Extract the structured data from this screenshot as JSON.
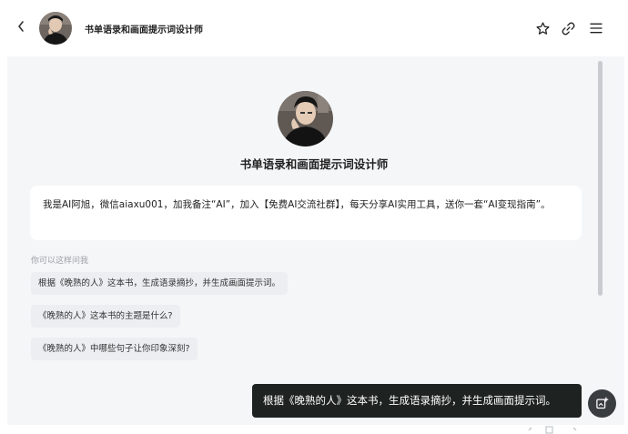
{
  "header": {
    "title": "书单语录和画面提示词设计师",
    "back_icon": "chevron-left-icon",
    "actions": [
      "star-icon",
      "link-icon",
      "menu-icon"
    ]
  },
  "bot": {
    "name": "书单语录和画面提示词设计师",
    "intro": "我是AI阿旭，微信aiaxu001，加我备注“AI”，加入【免费AI交流社群】，每天分享AI实用工具，送你一套“AI变现指南”。"
  },
  "suggestions": {
    "label": "你可以这样问我",
    "items": [
      "根据《晚熟的人》这本书，生成语录摘抄，并生成画面提示词。",
      "《晚熟的人》这本书的主题是什么?",
      "《晚熟的人》中哪些句子让你印象深刻?"
    ]
  },
  "user_message": "根据《晚熟的人》这本书，生成语录摘抄，并生成画面提示词。",
  "colors": {
    "chat_bg": "#f5f6f8",
    "user_bubble": "#1e2322",
    "chip_bg": "#eceef1"
  }
}
